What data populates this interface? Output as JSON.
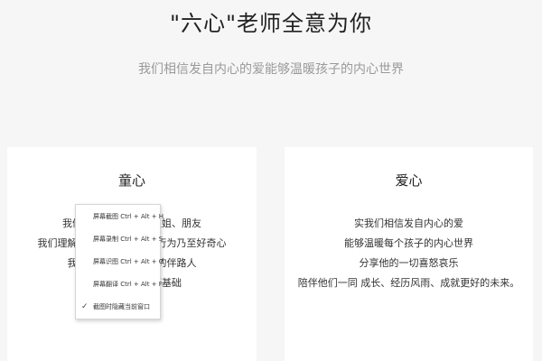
{
  "header": {
    "title": "\"六心\"老师全意为你",
    "subtitle": "我们相信发自内心的爱能够温暖孩子的内心世界"
  },
  "cards": [
    {
      "title": "童心",
      "lines": [
        "我们像孩子的哥哥、姐姐、朋友",
        "我们理解孩子的一切想法、行为乃至好奇心",
        "我们愿做孩子一路上的伴路人",
        "为孩子的成长打下基础"
      ]
    },
    {
      "title": "爱心",
      "lines": [
        "实我们相信发自内心的爱",
        "能够温暖每个孩子的内心世界",
        "分享他的一切喜怒哀乐",
        "陪伴他们一同 成长、经历风雨、成就更好的未来。"
      ]
    }
  ],
  "context_menu": {
    "items": [
      {
        "label": "屏幕截图 Ctrl + Alt + H",
        "checked": false
      },
      {
        "label": "屏幕录制 Ctrl + Alt + S",
        "checked": false
      },
      {
        "label": "屏幕识图 Ctrl + Alt + O",
        "checked": false
      },
      {
        "label": "屏幕翻译 Ctrl + Alt + F",
        "checked": false
      },
      {
        "label": "截图时隐藏当前窗口",
        "checked": true
      }
    ],
    "check_glyph": "✓"
  }
}
